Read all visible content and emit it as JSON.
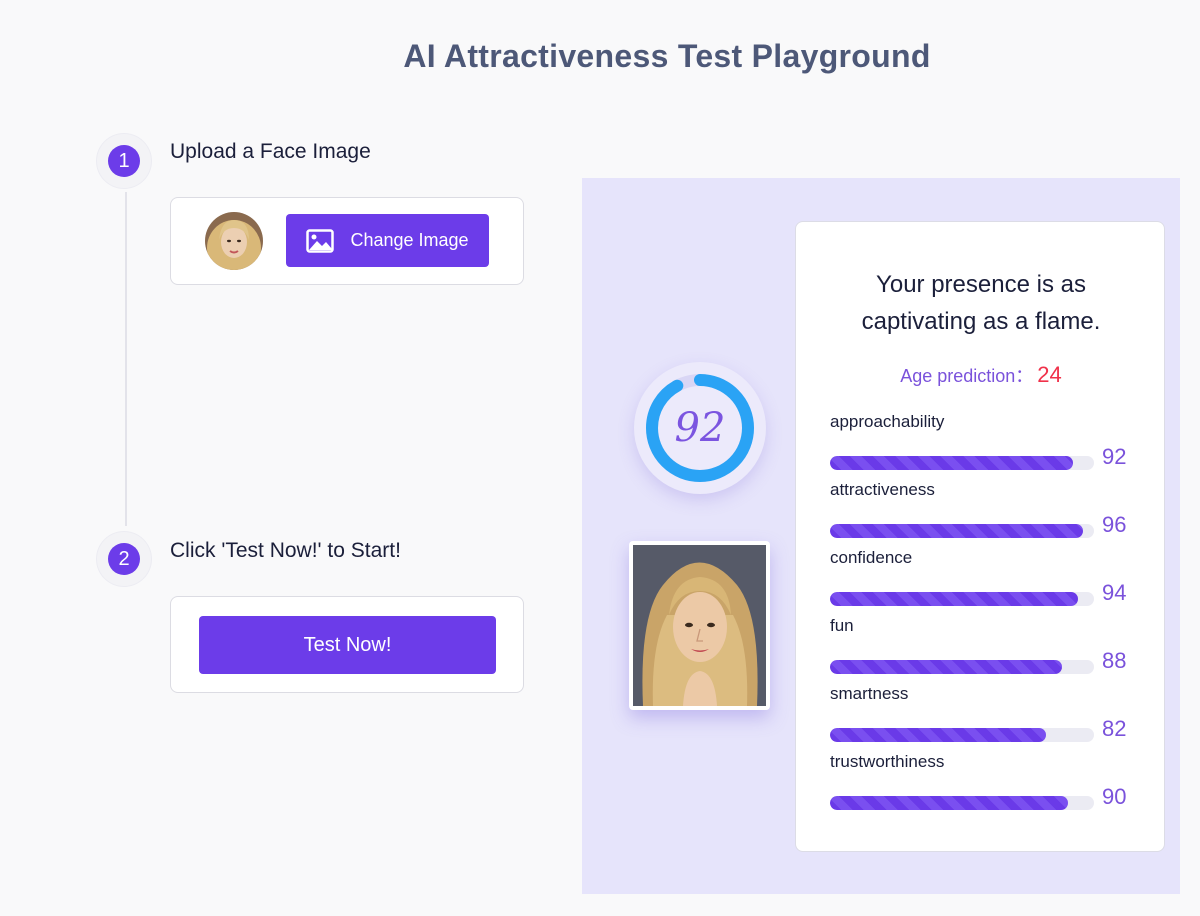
{
  "page": {
    "title": "AI Attractiveness Test Playground"
  },
  "steps": [
    {
      "number": "1",
      "label": "Upload a Face Image"
    },
    {
      "number": "2",
      "label": "Click 'Test Now!' to Start!"
    }
  ],
  "upload": {
    "change_image_label": "Change Image"
  },
  "test": {
    "button_label": "Test Now!"
  },
  "score": {
    "value": "92",
    "ring_fraction": 0.92,
    "ring_color": "#2aa3f5"
  },
  "result": {
    "headline": "Your presence is as captivating as a flame.",
    "age_label": "Age prediction：",
    "age_value": "24",
    "metrics": [
      {
        "label": "approachability",
        "value": "92",
        "fraction": 0.92
      },
      {
        "label": "attractiveness",
        "value": "96",
        "fraction": 0.96
      },
      {
        "label": "confidence",
        "value": "94",
        "fraction": 0.94
      },
      {
        "label": "fun",
        "value": "88",
        "fraction": 0.88
      },
      {
        "label": "smartness",
        "value": "82",
        "fraction": 0.82
      },
      {
        "label": "trustworthiness",
        "value": "90",
        "fraction": 0.9
      }
    ]
  },
  "colors": {
    "accent": "#6c3ce9",
    "panel_bg": "#e6e4fb",
    "age_value": "#f0314a"
  }
}
